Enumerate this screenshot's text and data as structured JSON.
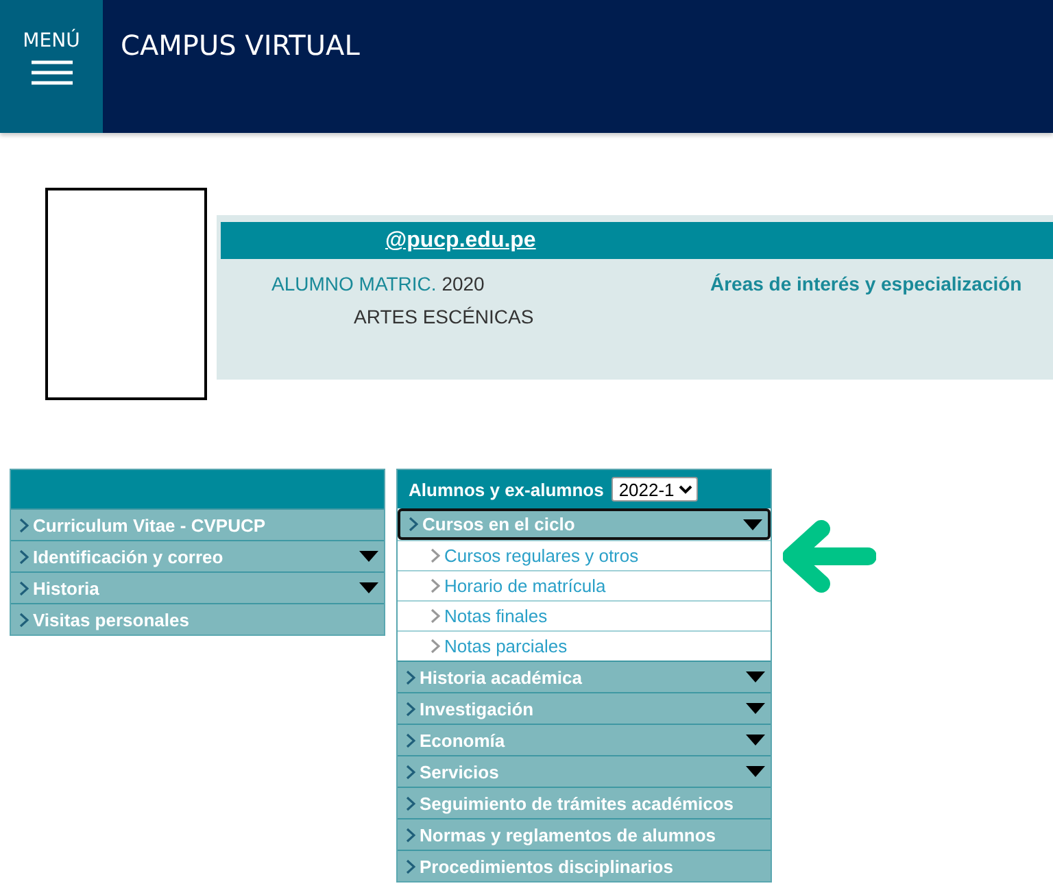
{
  "header": {
    "menu_label": "MENÚ",
    "title": "CAMPUS VIRTUAL"
  },
  "profile": {
    "email": "@pucp.edu.pe",
    "role_label": "ALUMNO MATRIC.",
    "year": "2020",
    "program": "ARTES ESCÉNICAS",
    "interests_link": "Áreas de interés y especialización"
  },
  "left_menu": {
    "items": [
      {
        "label": "Curriculum Vitae - CVPUCP",
        "has_dropdown": false
      },
      {
        "label": "Identificación y correo",
        "has_dropdown": true
      },
      {
        "label": "Historia",
        "has_dropdown": true
      },
      {
        "label": "Visitas personales",
        "has_dropdown": false
      }
    ]
  },
  "main_menu": {
    "title": "Alumnos y ex-alumnos",
    "term": "2022-1",
    "items": [
      {
        "label": "Cursos en el ciclo",
        "kind": "section",
        "has_dropdown": true,
        "focused": true
      },
      {
        "label": "Cursos regulares y otros",
        "kind": "link",
        "has_dropdown": false,
        "focused": false
      },
      {
        "label": "Horario de matrícula",
        "kind": "link",
        "has_dropdown": false,
        "focused": false
      },
      {
        "label": "Notas finales",
        "kind": "link",
        "has_dropdown": false,
        "focused": false
      },
      {
        "label": "Notas parciales",
        "kind": "link",
        "has_dropdown": false,
        "focused": false
      },
      {
        "label": "Historia académica",
        "kind": "section",
        "has_dropdown": true,
        "focused": false
      },
      {
        "label": "Investigación",
        "kind": "section",
        "has_dropdown": true,
        "focused": false
      },
      {
        "label": "Economía",
        "kind": "section",
        "has_dropdown": true,
        "focused": false
      },
      {
        "label": "Servicios",
        "kind": "section",
        "has_dropdown": true,
        "focused": false
      },
      {
        "label": "Seguimiento de trámites académicos",
        "kind": "section",
        "has_dropdown": false,
        "focused": false
      },
      {
        "label": "Normas y reglamentos de alumnos",
        "kind": "section",
        "has_dropdown": false,
        "focused": false
      },
      {
        "label": "Procedimientos disciplinarios",
        "kind": "section",
        "has_dropdown": false,
        "focused": false
      }
    ]
  }
}
